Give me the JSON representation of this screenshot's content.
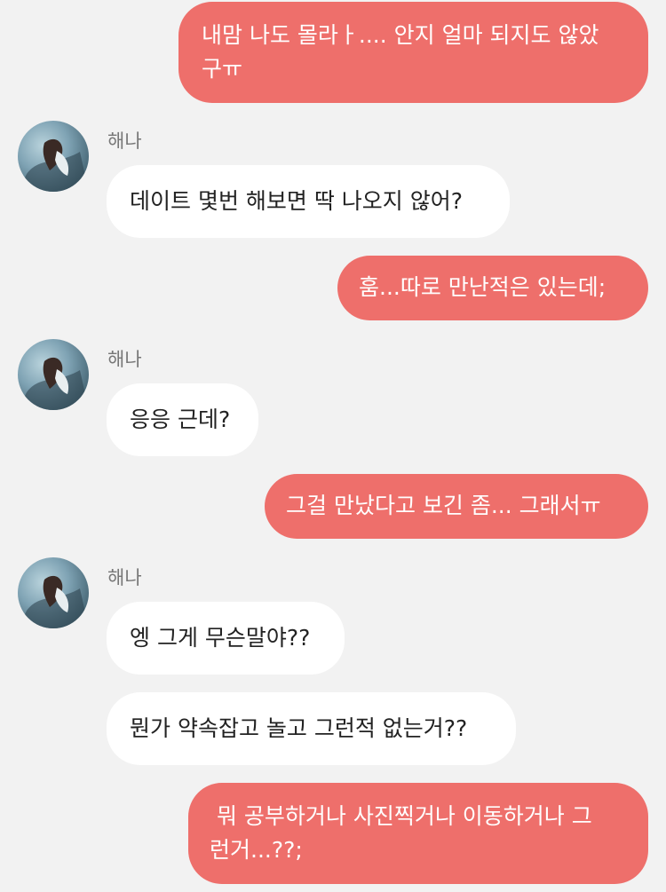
{
  "contact": {
    "name": "해나"
  },
  "colors": {
    "outgoing_bubble": "#ee6f6b",
    "incoming_bubble": "#ffffff",
    "background": "#f2f2f2"
  },
  "messages": [
    {
      "from": "me",
      "text": "내맘 나도 몰라ㅏ.... 안지 얼마 되지도 않았\n구ㅠ"
    },
    {
      "from": "해나",
      "text": "데이트 몇번 해보면 딱 나오지 않어?"
    },
    {
      "from": "me",
      "text": "훔...따로 만난적은 있는데;"
    },
    {
      "from": "해나",
      "text": "응응 근데?"
    },
    {
      "from": "me",
      "text": "그걸 만났다고 보긴 좀... 그래서ㅠ"
    },
    {
      "from": "해나",
      "text": "엥 그게 무슨말야??"
    },
    {
      "from": "해나",
      "text": "뭔가 약속잡고 놀고 그런적 없는거??"
    },
    {
      "from": "me",
      "text": " 뭐 공부하거나 사진찍거나 이동하거나 그\n런거...??;"
    }
  ]
}
